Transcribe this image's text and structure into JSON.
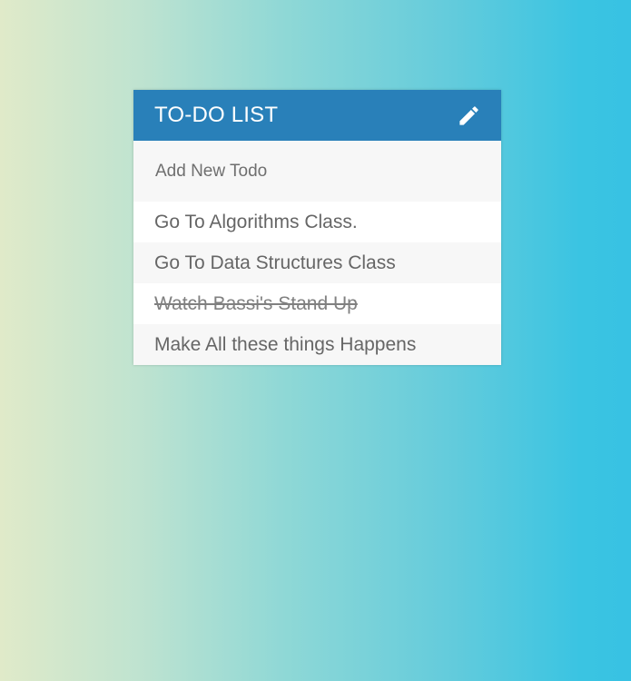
{
  "header": {
    "title": "TO-DO LIST",
    "edit_icon": "pencil-icon"
  },
  "new_todo": {
    "placeholder": "Add New Todo",
    "value": ""
  },
  "todos": [
    {
      "text": "Go To Algorithms Class.",
      "completed": false
    },
    {
      "text": "Go To Data Structures Class",
      "completed": false
    },
    {
      "text": "Watch Bassi's Stand Up",
      "completed": true
    },
    {
      "text": "Make All these things Happens",
      "completed": false
    }
  ],
  "colors": {
    "header_bg": "#2980b9",
    "gradient_start": "#e0eac9",
    "gradient_end": "#38c2e3",
    "text": "#666666"
  }
}
